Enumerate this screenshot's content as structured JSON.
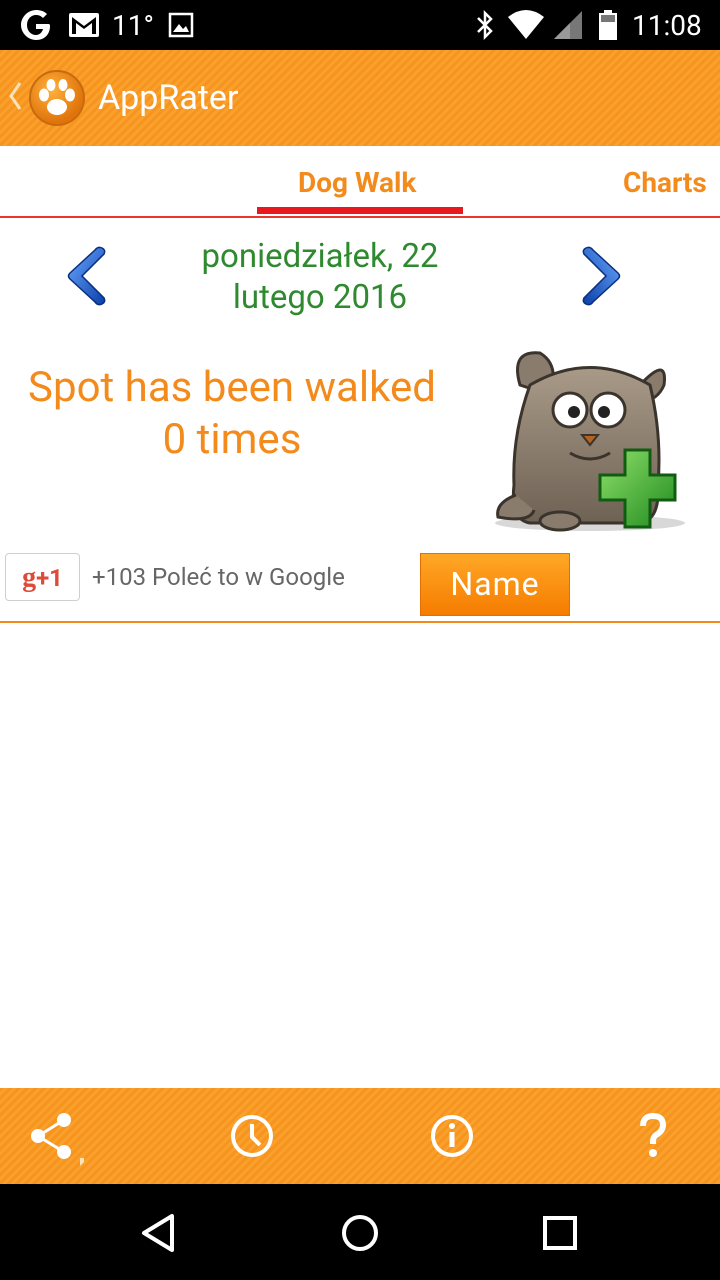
{
  "status_bar": {
    "temperature": "11°",
    "time": "11:08",
    "icons": [
      "google-icon",
      "gmail-icon",
      "image-icon",
      "bluetooth-icon",
      "wifi-icon",
      "signal-icon",
      "battery-icon"
    ]
  },
  "action_bar": {
    "title": "AppRater",
    "icons": [
      "back-chevron-icon",
      "paw-logo-icon"
    ]
  },
  "tabs": [
    {
      "label": "Dog Walk",
      "active": true
    },
    {
      "label": "Charts",
      "active": false
    }
  ],
  "date_nav": {
    "line1": "poniedziałek, 22",
    "line2": "lutego 2016",
    "icons": [
      "chevron-left-icon",
      "chevron-right-icon"
    ]
  },
  "walk": {
    "line1": "Spot has been walked",
    "line2": "0 times",
    "icon": "dog-add-icon"
  },
  "social": {
    "gplus_g": "g",
    "gplus_plus": "+1",
    "gplus_text": "+103 Poleć to w Google",
    "name_button": "Name"
  },
  "bottom_bar": {
    "icons": [
      "share-icon",
      "clock-icon",
      "info-icon",
      "help-icon"
    ]
  },
  "nav_bar": {
    "icons": [
      "back-icon",
      "home-icon",
      "recents-icon"
    ]
  },
  "colors": {
    "accent": "#f38b1c",
    "date_green": "#2f8a2f",
    "tab_indicator": "#e8181e"
  }
}
